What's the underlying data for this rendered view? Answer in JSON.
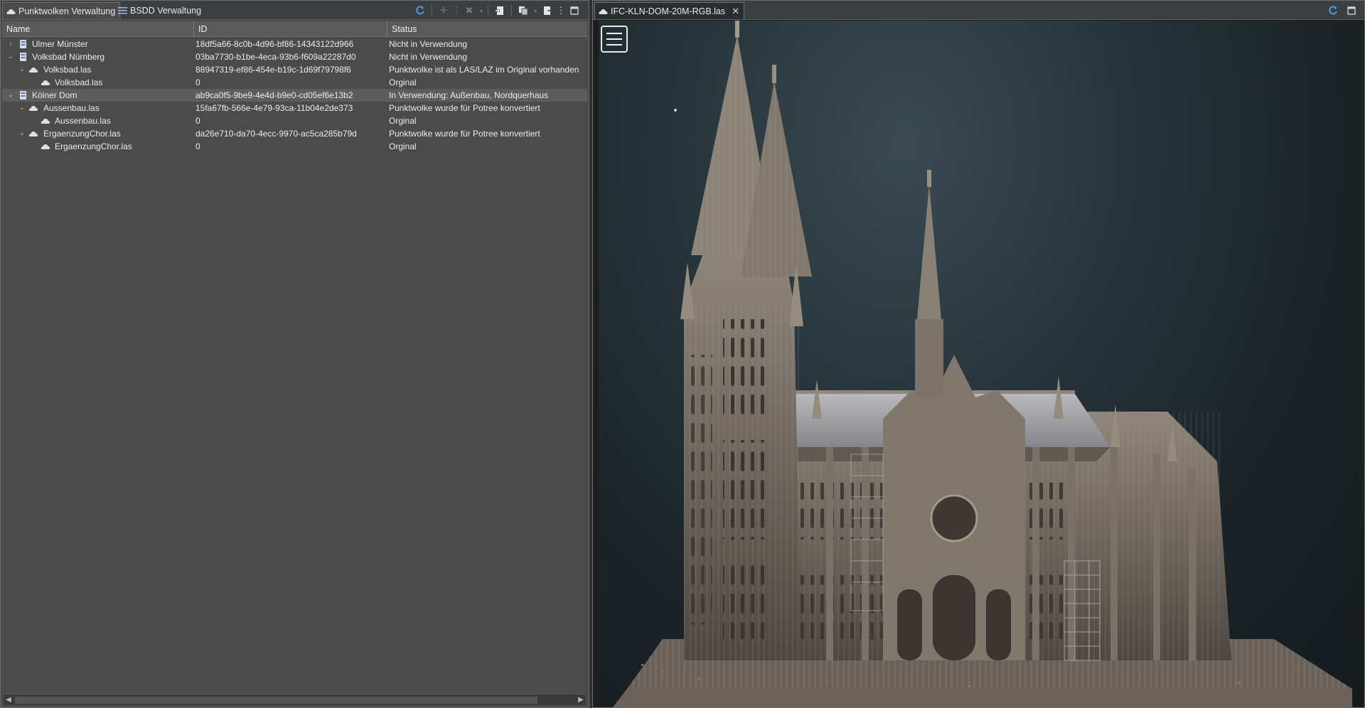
{
  "left_panel": {
    "tabs": [
      {
        "label": "Punktwolken Verwaltung"
      },
      {
        "label": "BSDD Verwaltung"
      }
    ],
    "columns": {
      "name": "Name",
      "id": "ID",
      "status": "Status"
    },
    "rows": [
      {
        "name": "Ulmer Münster",
        "id": "18df5a66-8c0b-4d96-bf86-14343122d966",
        "status": "Nicht in Verwendung"
      },
      {
        "name": "Volksbad Nürnberg",
        "id": "03ba7730-b1be-4eca-93b6-f609a22287d0",
        "status": "Nicht in Verwendung"
      },
      {
        "name": "Volksbad.las",
        "id": "88947319-ef86-454e-b19c-1d69f79798f6",
        "status": "Punktwolke ist als LAS/LAZ im Original vorhanden"
      },
      {
        "name": "Volksbad.las",
        "id": "0",
        "status": "Orginal"
      },
      {
        "name": "Kölner Dom",
        "id": "ab9ca0f5-9be9-4e4d-b9e0-cd05ef6e13b2",
        "status": "In Verwendung: Außenbau, Nordquerhaus"
      },
      {
        "name": "Aussenbau.las",
        "id": "15fa67fb-566e-4e79-93ca-11b04e2de373",
        "status": "Punktwolke wurde für Potree konvertiert"
      },
      {
        "name": "Aussenbau.las",
        "id": "0",
        "status": "Orginal"
      },
      {
        "name": "ErgaenzungChor.las",
        "id": "da26e710-da70-4ecc-9970-ac5ca285b79d",
        "status": "Punktwolke wurde für Potree konvertiert"
      },
      {
        "name": "ErgaenzungChor.las",
        "id": "0",
        "status": "Orginal"
      }
    ]
  },
  "right_panel": {
    "tab_label": "IFC-KLN-DOM-20M-RGB.las"
  },
  "colors": {
    "panel_bg": "#4b4b4b",
    "tabbar_bg": "#3c3f41",
    "selection": "#5d5d5d",
    "viewport_bg": "#1c2428",
    "accent_blue": "#4a9be0"
  }
}
